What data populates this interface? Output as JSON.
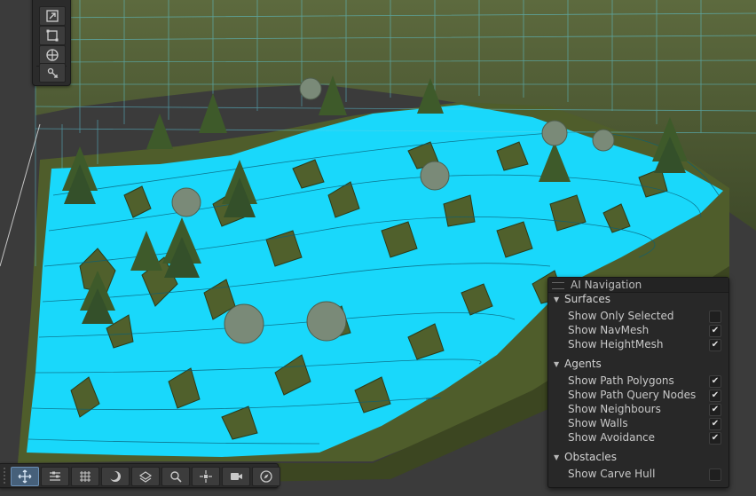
{
  "ai_navigation": {
    "title": "AI Navigation",
    "sections": [
      {
        "label": "Surfaces",
        "items": [
          {
            "label": "Show Only Selected",
            "checked": false
          },
          {
            "label": "Show NavMesh",
            "checked": true
          },
          {
            "label": "Show HeightMesh",
            "checked": true
          }
        ]
      },
      {
        "label": "Agents",
        "items": [
          {
            "label": "Show Path Polygons",
            "checked": true
          },
          {
            "label": "Show Path Query Nodes",
            "checked": true
          },
          {
            "label": "Show Neighbours",
            "checked": true
          },
          {
            "label": "Show Walls",
            "checked": true
          },
          {
            "label": "Show Avoidance",
            "checked": true
          }
        ]
      },
      {
        "label": "Obstacles",
        "items": [
          {
            "label": "Show Carve Hull",
            "checked": false
          }
        ]
      }
    ]
  },
  "tool_strip": {
    "tools": [
      "scale-tool-icon",
      "rect-tool-icon",
      "transform-tool-icon",
      "custom-tool-icon"
    ]
  },
  "bottom_toolbar": {
    "tools": [
      "move-grip-icon",
      "tool-settings-icon",
      "grid-snapping-icon",
      "render-mode-icon",
      "layers-icon",
      "search-icon",
      "pivot-icon",
      "camera-icon",
      "compass-icon"
    ]
  },
  "colors": {
    "navmesh": "#18dcff",
    "terrain": "#4e5b2a",
    "tree": "#3f5a2c",
    "grid": "#5fd3e8",
    "panel": "#282828"
  }
}
